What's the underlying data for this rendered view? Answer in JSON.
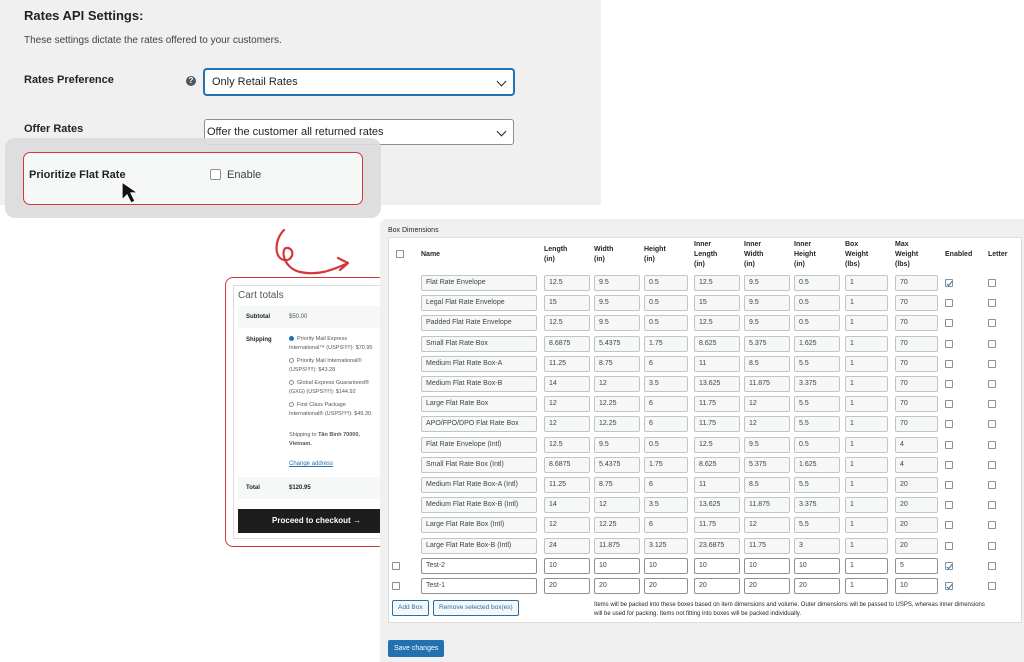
{
  "settings": {
    "title": "Rates API Settings:",
    "description": "These settings dictate the rates offered to your customers.",
    "rates_preference_label": "Rates Preference",
    "rates_preference_value": "Only Retail Rates",
    "offer_rates_label": "Offer Rates",
    "offer_rates_value": "Offer the customer all returned rates",
    "prioritize_label": "Prioritize Flat Rate",
    "enable_label": "Enable",
    "help_icon": "?"
  },
  "cart": {
    "title": "Cart totals",
    "subtotal_label": "Subtotal",
    "subtotal_value": "$50.00",
    "shipping_label": "Shipping",
    "options": [
      {
        "line1": "Priority Mail Express",
        "line2": "International™ (USPS!!!!!): $70.95",
        "selected": true
      },
      {
        "line1": "Priority Mail International®",
        "line2": "(USPS!!!!!): $43.28",
        "selected": false
      },
      {
        "line1": "Global Express Guaranteed®",
        "line2": "(GXG) (USPS!!!!!): $144.92",
        "selected": false
      },
      {
        "line1": "First Class Package",
        "line2": "International® (USPS!!!!!): $49.30",
        "selected": false
      }
    ],
    "ship_to_prefix": "Shipping to ",
    "ship_to_place": "Tân Bình 70000,",
    "ship_to_country": "Vietnam.",
    "change_address": "Change address",
    "total_label": "Total",
    "total_value": "$120.95",
    "checkout_button": "Proceed to checkout →"
  },
  "boxes": {
    "title": "Box Dimensions",
    "headers": [
      "Name",
      "Length\n(in)",
      "Width\n(in)",
      "Height\n(in)",
      "Inner\nLength\n(in)",
      "Inner\nWidth\n(in)",
      "Inner\nHeight\n(in)",
      "Box\nWeight\n(lbs)",
      "Max\nWeight\n(lbs)",
      "Enabled",
      "Letter"
    ],
    "rows": [
      {
        "name": "Flat Rate Envelope",
        "length": "12.5",
        "width": "9.5",
        "height": "0.5",
        "inner_length": "12.5",
        "inner_width": "9.5",
        "inner_height": "0.5",
        "box_weight": "1",
        "max_weight": "70",
        "enabled": true,
        "letter": false,
        "custom": false
      },
      {
        "name": "Legal Flat Rate Envelope",
        "length": "15",
        "width": "9.5",
        "height": "0.5",
        "inner_length": "15",
        "inner_width": "9.5",
        "inner_height": "0.5",
        "box_weight": "1",
        "max_weight": "70",
        "enabled": false,
        "letter": false,
        "custom": false
      },
      {
        "name": "Padded Flat Rate Envelope",
        "length": "12.5",
        "width": "9.5",
        "height": "0.5",
        "inner_length": "12.5",
        "inner_width": "9.5",
        "inner_height": "0.5",
        "box_weight": "1",
        "max_weight": "70",
        "enabled": false,
        "letter": false,
        "custom": false
      },
      {
        "name": "Small Flat Rate Box",
        "length": "8.6875",
        "width": "5.4375",
        "height": "1.75",
        "inner_length": "8.625",
        "inner_width": "5.375",
        "inner_height": "1.625",
        "box_weight": "1",
        "max_weight": "70",
        "enabled": false,
        "letter": false,
        "custom": false
      },
      {
        "name": "Medium Flat Rate Box-A",
        "length": "11.25",
        "width": "8.75",
        "height": "6",
        "inner_length": "11",
        "inner_width": "8.5",
        "inner_height": "5.5",
        "box_weight": "1",
        "max_weight": "70",
        "enabled": false,
        "letter": false,
        "custom": false
      },
      {
        "name": "Medium Flat Rate Box-B",
        "length": "14",
        "width": "12",
        "height": "3.5",
        "inner_length": "13.625",
        "inner_width": "11.875",
        "inner_height": "3.375",
        "box_weight": "1",
        "max_weight": "70",
        "enabled": false,
        "letter": false,
        "custom": false
      },
      {
        "name": "Large Flat Rate Box",
        "length": "12",
        "width": "12.25",
        "height": "6",
        "inner_length": "11.75",
        "inner_width": "12",
        "inner_height": "5.5",
        "box_weight": "1",
        "max_weight": "70",
        "enabled": false,
        "letter": false,
        "custom": false
      },
      {
        "name": "APO/FPO/DPO Flat Rate Box",
        "length": "12",
        "width": "12.25",
        "height": "6",
        "inner_length": "11.75",
        "inner_width": "12",
        "inner_height": "5.5",
        "box_weight": "1",
        "max_weight": "70",
        "enabled": false,
        "letter": false,
        "custom": false
      },
      {
        "name": "Flat Rate Envelope (Intl)",
        "length": "12.5",
        "width": "9.5",
        "height": "0.5",
        "inner_length": "12.5",
        "inner_width": "9.5",
        "inner_height": "0.5",
        "box_weight": "1",
        "max_weight": "4",
        "enabled": false,
        "letter": false,
        "custom": false
      },
      {
        "name": "Small Flat Rate Box (Intl)",
        "length": "8.6875",
        "width": "5.4375",
        "height": "1.75",
        "inner_length": "8.625",
        "inner_width": "5.375",
        "inner_height": "1.625",
        "box_weight": "1",
        "max_weight": "4",
        "enabled": false,
        "letter": false,
        "custom": false
      },
      {
        "name": "Medium Flat Rate Box-A (Intl)",
        "length": "11.25",
        "width": "8.75",
        "height": "6",
        "inner_length": "11",
        "inner_width": "8.5",
        "inner_height": "5.5",
        "box_weight": "1",
        "max_weight": "20",
        "enabled": false,
        "letter": false,
        "custom": false
      },
      {
        "name": "Medium Flat Rate Box-B (Intl)",
        "length": "14",
        "width": "12",
        "height": "3.5",
        "inner_length": "13.625",
        "inner_width": "11.875",
        "inner_height": "3.375",
        "box_weight": "1",
        "max_weight": "20",
        "enabled": false,
        "letter": false,
        "custom": false
      },
      {
        "name": "Large Flat Rate Box (Intl)",
        "length": "12",
        "width": "12.25",
        "height": "6",
        "inner_length": "11.75",
        "inner_width": "12",
        "inner_height": "5.5",
        "box_weight": "1",
        "max_weight": "20",
        "enabled": false,
        "letter": false,
        "custom": false
      },
      {
        "name": "Large Flat Rate Box-B (Intl)",
        "length": "24",
        "width": "11.875",
        "height": "3.125",
        "inner_length": "23.6875",
        "inner_width": "11.75",
        "inner_height": "3",
        "box_weight": "1",
        "max_weight": "20",
        "enabled": false,
        "letter": false,
        "custom": false
      },
      {
        "name": "Test-2",
        "length": "10",
        "width": "10",
        "height": "10",
        "inner_length": "10",
        "inner_width": "10",
        "inner_height": "10",
        "box_weight": "1",
        "max_weight": "5",
        "enabled": true,
        "letter": false,
        "custom": true
      },
      {
        "name": "Test-1",
        "length": "20",
        "width": "20",
        "height": "20",
        "inner_length": "20",
        "inner_width": "20",
        "inner_height": "20",
        "box_weight": "1",
        "max_weight": "10",
        "enabled": true,
        "letter": false,
        "custom": true
      }
    ],
    "add_box": "Add Box",
    "remove_selected": "Remove selected box(es)",
    "note": "Items will be packed into these boxes based on item dimensions and volume. Outer dimensions will be passed to USPS, whereas inner dimensions will be used for packing. Items not fitting into boxes will be packed individually.",
    "save_changes": "Save changes"
  },
  "colors": {
    "accent": "#2271b1",
    "highlight": "#d63638"
  }
}
